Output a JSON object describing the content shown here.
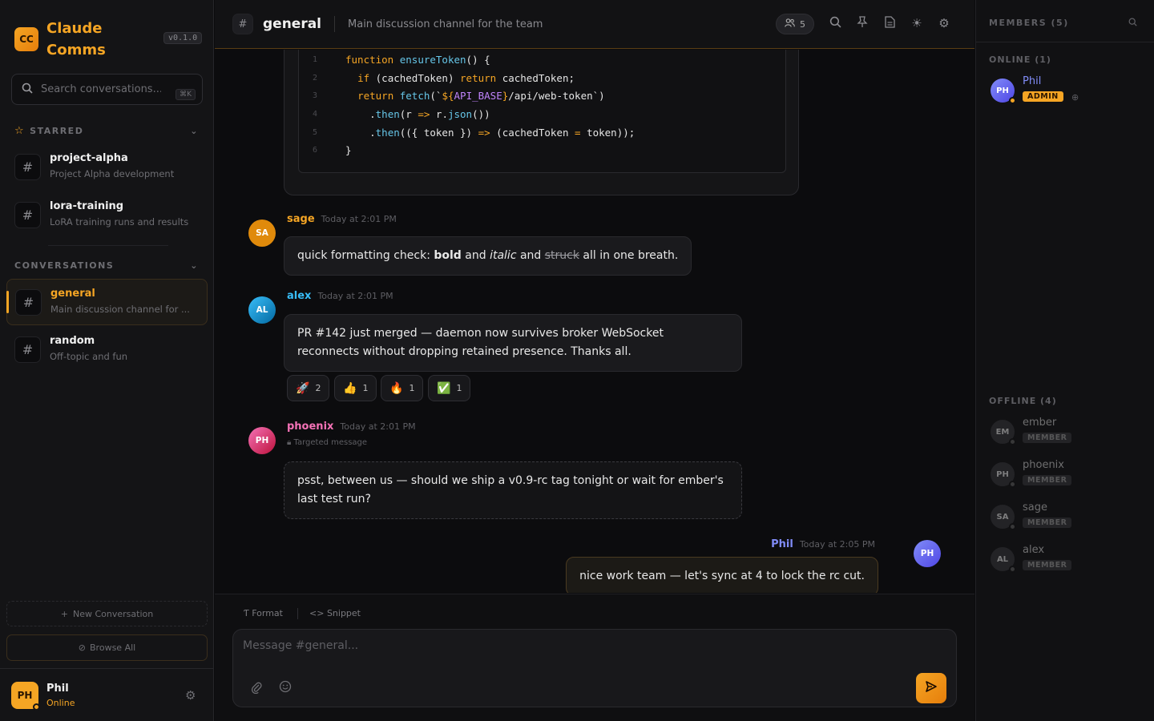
{
  "brand": {
    "logo": "CC",
    "name": "Claude Comms",
    "version": "v0.1.0"
  },
  "search": {
    "placeholder": "Search conversations...",
    "shortcut": "⌘K"
  },
  "sidebar": {
    "starred_label": "STARRED",
    "conversations_label": "CONVERSATIONS",
    "starred": [
      {
        "name": "project-alpha",
        "desc": "Project Alpha development"
      },
      {
        "name": "lora-training",
        "desc": "LoRA training runs and results"
      }
    ],
    "conversations": [
      {
        "name": "general",
        "desc": "Main discussion channel for ...",
        "active": true
      },
      {
        "name": "random",
        "desc": "Off-topic and fun"
      }
    ],
    "new_conversation": "New Conversation",
    "browse_all": "Browse All"
  },
  "current_user": {
    "initials": "PH",
    "name": "Phil",
    "status": "Online"
  },
  "channel": {
    "name": "general",
    "description": "Main discussion channel for the team",
    "member_count": "5"
  },
  "code_block": {
    "lines": [
      {
        "n": "1",
        "code": "function ensureToken() {"
      },
      {
        "n": "2",
        "code": "  if (cachedToken) return cachedToken;"
      },
      {
        "n": "3",
        "code": "  return fetch(`${API_BASE}/api/web-token`)"
      },
      {
        "n": "4",
        "code": "    .then(r => r.json())"
      },
      {
        "n": "5",
        "code": "    .then(({ token }) => (cachedToken = token));"
      },
      {
        "n": "6",
        "code": "}"
      }
    ]
  },
  "messages": [
    {
      "initials": "SA",
      "user": "sage",
      "time": "Today at 2:01 PM",
      "text_parts": [
        "quick formatting check: ",
        "bold",
        " and ",
        "italic",
        " and ",
        "struck",
        " all in one breath."
      ]
    },
    {
      "initials": "AL",
      "user": "alex",
      "time": "Today at 2:01 PM",
      "text": "PR #142 just merged — daemon now survives broker WebSocket reconnects without dropping retained presence. Thanks all.",
      "reactions": [
        {
          "emoji": "🚀",
          "count": "2"
        },
        {
          "emoji": "👍",
          "count": "1"
        },
        {
          "emoji": "🔥",
          "count": "1"
        },
        {
          "emoji": "✅",
          "count": "1"
        }
      ]
    },
    {
      "initials": "PH",
      "user": "phoenix",
      "time": "Today at 2:01 PM",
      "tag": "Targeted message",
      "text": "psst, between us — should we ship a v0.9-rc tag tonight or wait for ember's last test run?"
    },
    {
      "initials": "PH",
      "user": "Phil",
      "time": "Today at 2:05 PM",
      "text": "nice work team — let's sync at 4 to lock the rc cut."
    }
  ],
  "composer": {
    "format": "Format",
    "snippet": "Snippet",
    "placeholder": "Message #general..."
  },
  "members_panel": {
    "title": "MEMBERS (5)",
    "online_label": "ONLINE (1)",
    "offline_label": "OFFLINE (4)",
    "online": [
      {
        "initials": "PH",
        "name": "Phil",
        "role": "ADMIN"
      }
    ],
    "offline": [
      {
        "initials": "EM",
        "name": "ember",
        "role": "MEMBER"
      },
      {
        "initials": "PH",
        "name": "phoenix",
        "role": "MEMBER"
      },
      {
        "initials": "SA",
        "name": "sage",
        "role": "MEMBER"
      },
      {
        "initials": "AL",
        "name": "alex",
        "role": "MEMBER"
      }
    ]
  },
  "colors": {
    "accent": "#f5a524",
    "sage": "#f5a524",
    "alex": "#38bdf8",
    "phoenix": "#f472b6",
    "phil": "#818cf8",
    "online": "#f5a524",
    "offline": "#555555"
  }
}
